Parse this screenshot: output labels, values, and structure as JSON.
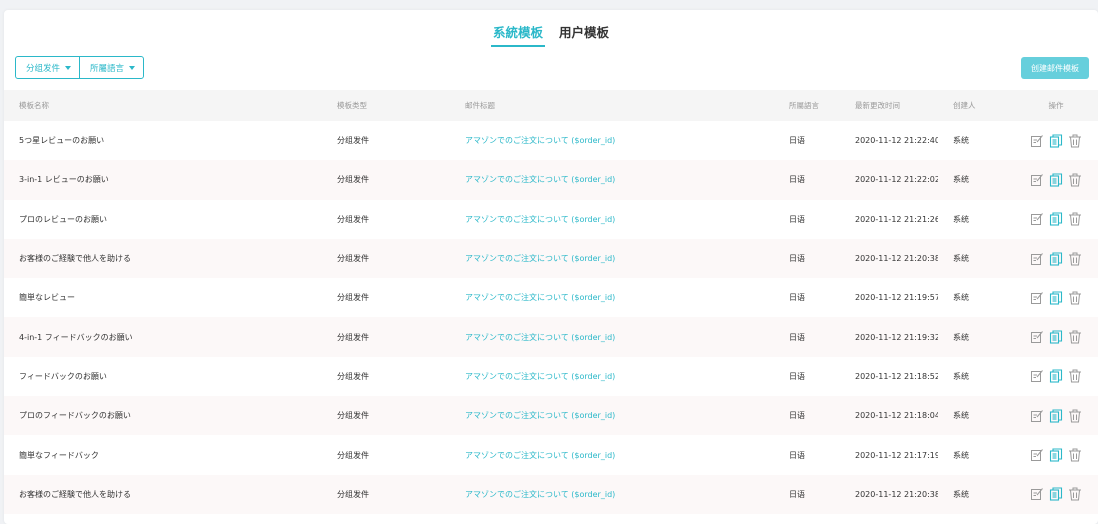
{
  "tabs": [
    {
      "label": "系統模板",
      "active": true
    },
    {
      "label": "用户模板",
      "active": false
    }
  ],
  "filters": [
    {
      "label": "分组发件"
    },
    {
      "label": "所屬語言"
    }
  ],
  "create_button": {
    "label": "创建邮件模板"
  },
  "columns": [
    "模板名称",
    "模板类型",
    "邮件标题",
    "所屬語言",
    "最新更改时间",
    "创建人",
    "操作"
  ],
  "rows": [
    {
      "name": "5つ星レビューのお願い",
      "type": "分组发件",
      "subject": "アマゾンでのご注文について ($order_id)",
      "language": "日语",
      "time": "2020-11-12 21:22:40",
      "creator": "系统"
    },
    {
      "name": "3-in-1 レビューのお願い",
      "type": "分组发件",
      "subject": "アマゾンでのご注文について ($order_id)",
      "language": "日语",
      "time": "2020-11-12 21:22:02",
      "creator": "系统"
    },
    {
      "name": "プロのレビューのお願い",
      "type": "分组发件",
      "subject": "アマゾンでのご注文について ($order_id)",
      "language": "日语",
      "time": "2020-11-12 21:21:26",
      "creator": "系统"
    },
    {
      "name": "お客様のご経験で他人を助ける",
      "type": "分组发件",
      "subject": "アマゾンでのご注文について ($order_id)",
      "language": "日语",
      "time": "2020-11-12 21:20:38",
      "creator": "系统"
    },
    {
      "name": "簡単なレビュー",
      "type": "分组发件",
      "subject": "アマゾンでのご注文について ($order_id)",
      "language": "日语",
      "time": "2020-11-12 21:19:57",
      "creator": "系统"
    },
    {
      "name": "4-in-1 フィードバックのお願い",
      "type": "分组发件",
      "subject": "アマゾンでのご注文について ($order_id)",
      "language": "日语",
      "time": "2020-11-12 21:19:32",
      "creator": "系统"
    },
    {
      "name": "フィードバックのお願い",
      "type": "分组发件",
      "subject": "アマゾンでのご注文について ($order_id)",
      "language": "日语",
      "time": "2020-11-12 21:18:52",
      "creator": "系统"
    },
    {
      "name": "プロのフィードバックのお願い",
      "type": "分组发件",
      "subject": "アマゾンでのご注文について ($order_id)",
      "language": "日语",
      "time": "2020-11-12 21:18:04",
      "creator": "系统"
    },
    {
      "name": "簡単なフィードバック",
      "type": "分组发件",
      "subject": "アマゾンでのご注文について ($order_id)",
      "language": "日语",
      "time": "2020-11-12 21:17:19",
      "creator": "系统"
    },
    {
      "name": "お客様のご経験で他人を助ける",
      "type": "分组发件",
      "subject": "アマゾンでのご注文について ($order_id)",
      "language": "日语",
      "time": "2020-11-12 21:20:38",
      "creator": "系统"
    }
  ],
  "row_actions": [
    {
      "icon": "edit-icon",
      "color": "#9a9a9a"
    },
    {
      "icon": "copy-icon",
      "color": "#2bb8c9"
    },
    {
      "icon": "trash-icon",
      "color": "#9a9a9a"
    }
  ],
  "colors": {
    "accent": "#2bb8c9",
    "button_bg": "#66cfdc",
    "header_bg": "#f5f5f5",
    "row_alt_bg": "#fcf8f8"
  }
}
